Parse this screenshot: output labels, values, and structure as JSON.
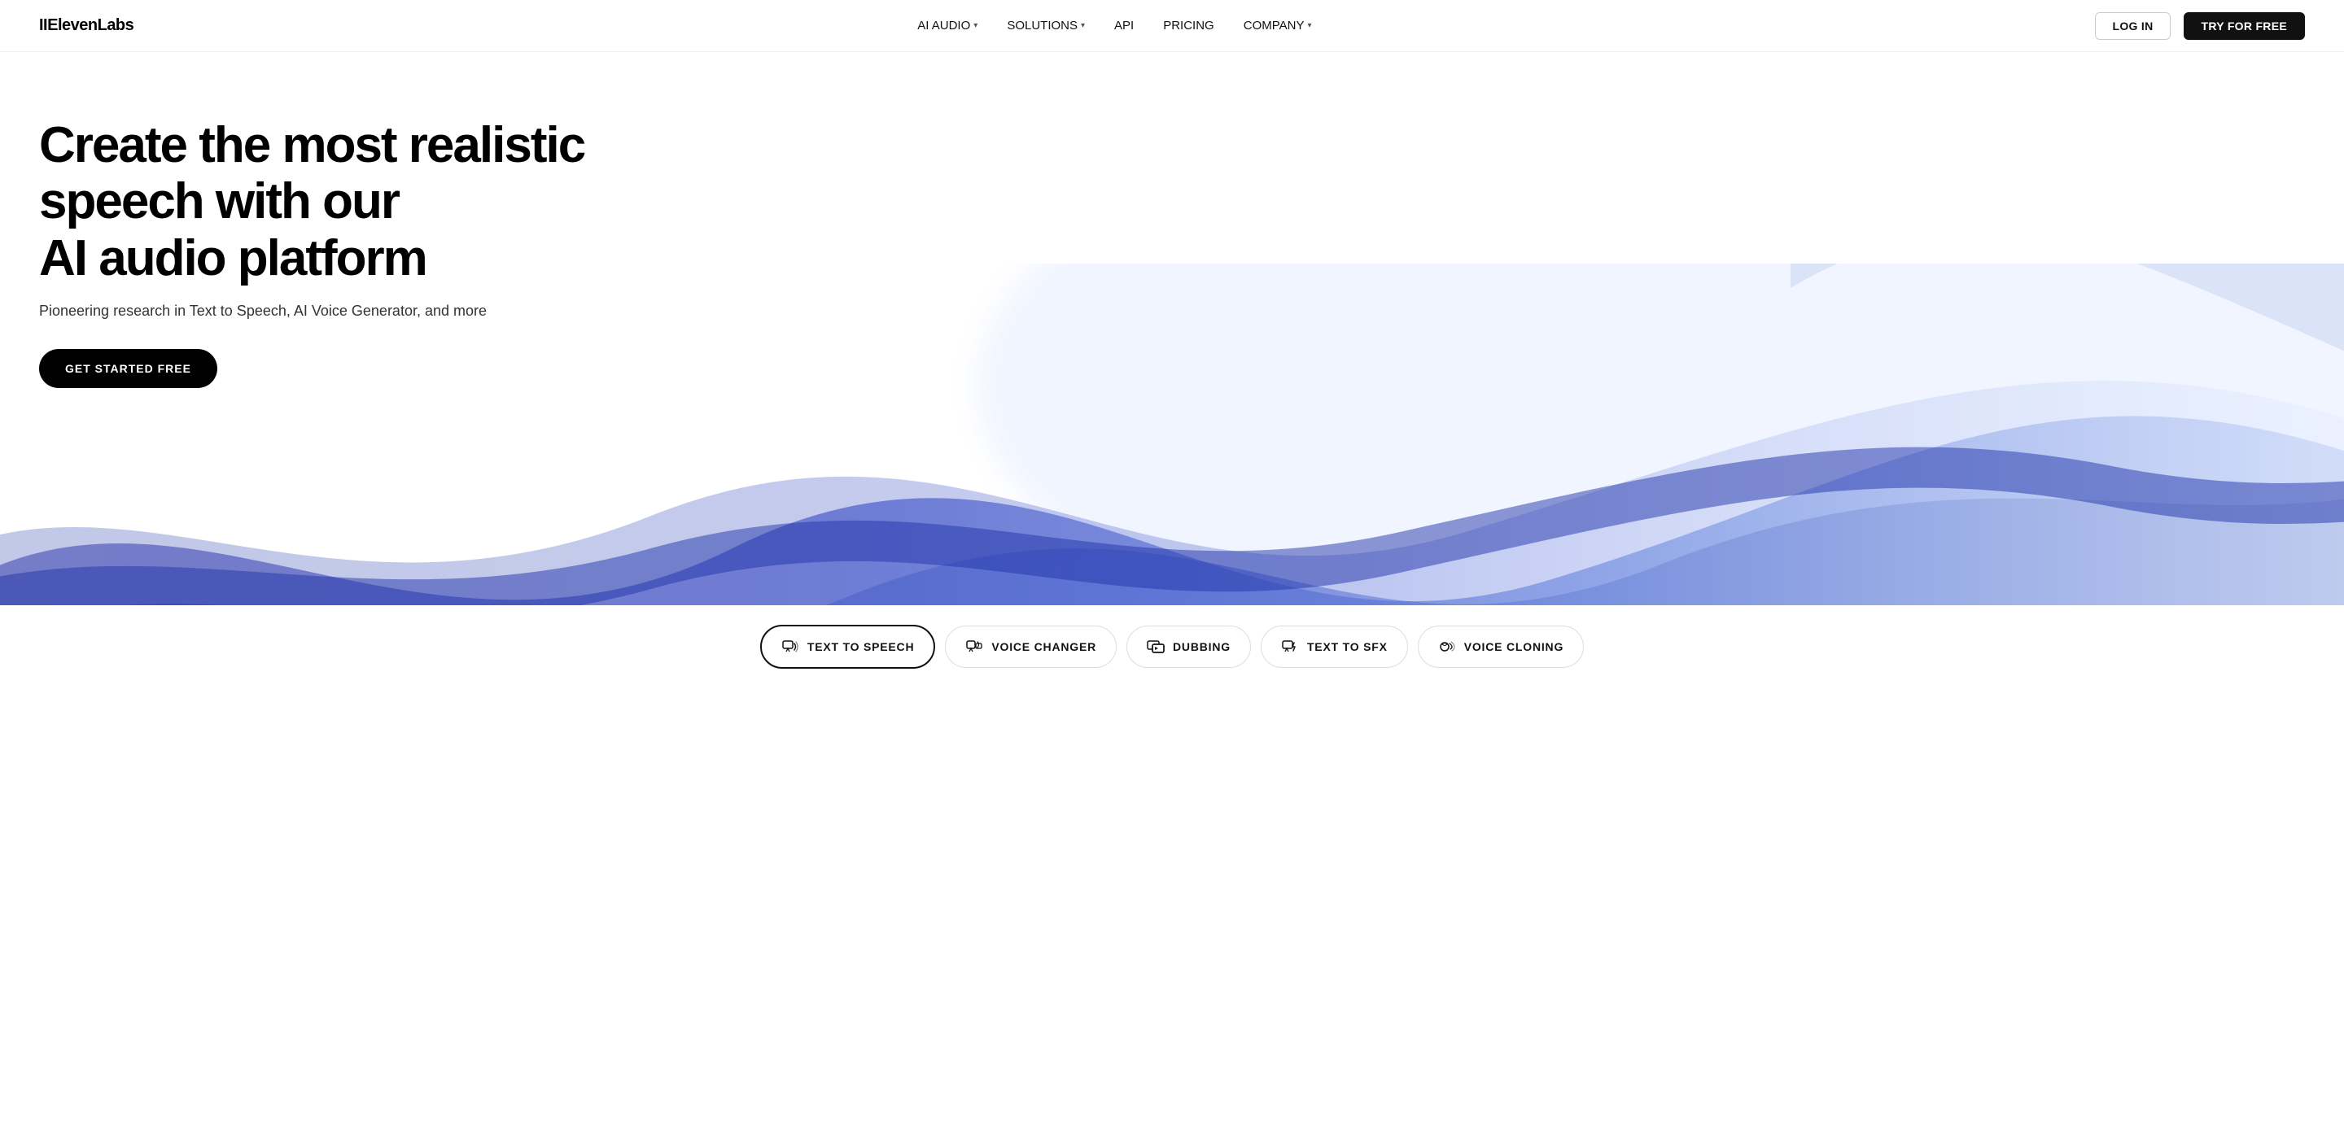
{
  "nav": {
    "logo": "IIElevenLabs",
    "links": [
      {
        "label": "AI AUDIO",
        "hasDropdown": true,
        "id": "ai-audio"
      },
      {
        "label": "SOLUTIONS",
        "hasDropdown": true,
        "id": "solutions"
      },
      {
        "label": "API",
        "hasDropdown": false,
        "id": "api"
      },
      {
        "label": "PRICING",
        "hasDropdown": false,
        "id": "pricing"
      },
      {
        "label": "COMPANY",
        "hasDropdown": true,
        "id": "company"
      }
    ],
    "login_label": "LOG IN",
    "try_label": "TRY FOR FREE"
  },
  "hero": {
    "title_line1": "Create the most realistic speech with our",
    "title_line2": "AI audio platform",
    "subtitle": "Pioneering research in Text to Speech, AI Voice Generator, and more",
    "cta_label": "GET STARTED FREE"
  },
  "tabs": [
    {
      "label": "TEXT TO SPEECH",
      "icon": "text-to-speech-icon",
      "active": true
    },
    {
      "label": "VOICE CHANGER",
      "icon": "voice-changer-icon",
      "active": false
    },
    {
      "label": "DUBBING",
      "icon": "dubbing-icon",
      "active": false
    },
    {
      "label": "TEXT TO SFX",
      "icon": "text-to-sfx-icon",
      "active": false
    },
    {
      "label": "VOICE CLONING",
      "icon": "voice-cloning-icon",
      "active": false
    }
  ]
}
